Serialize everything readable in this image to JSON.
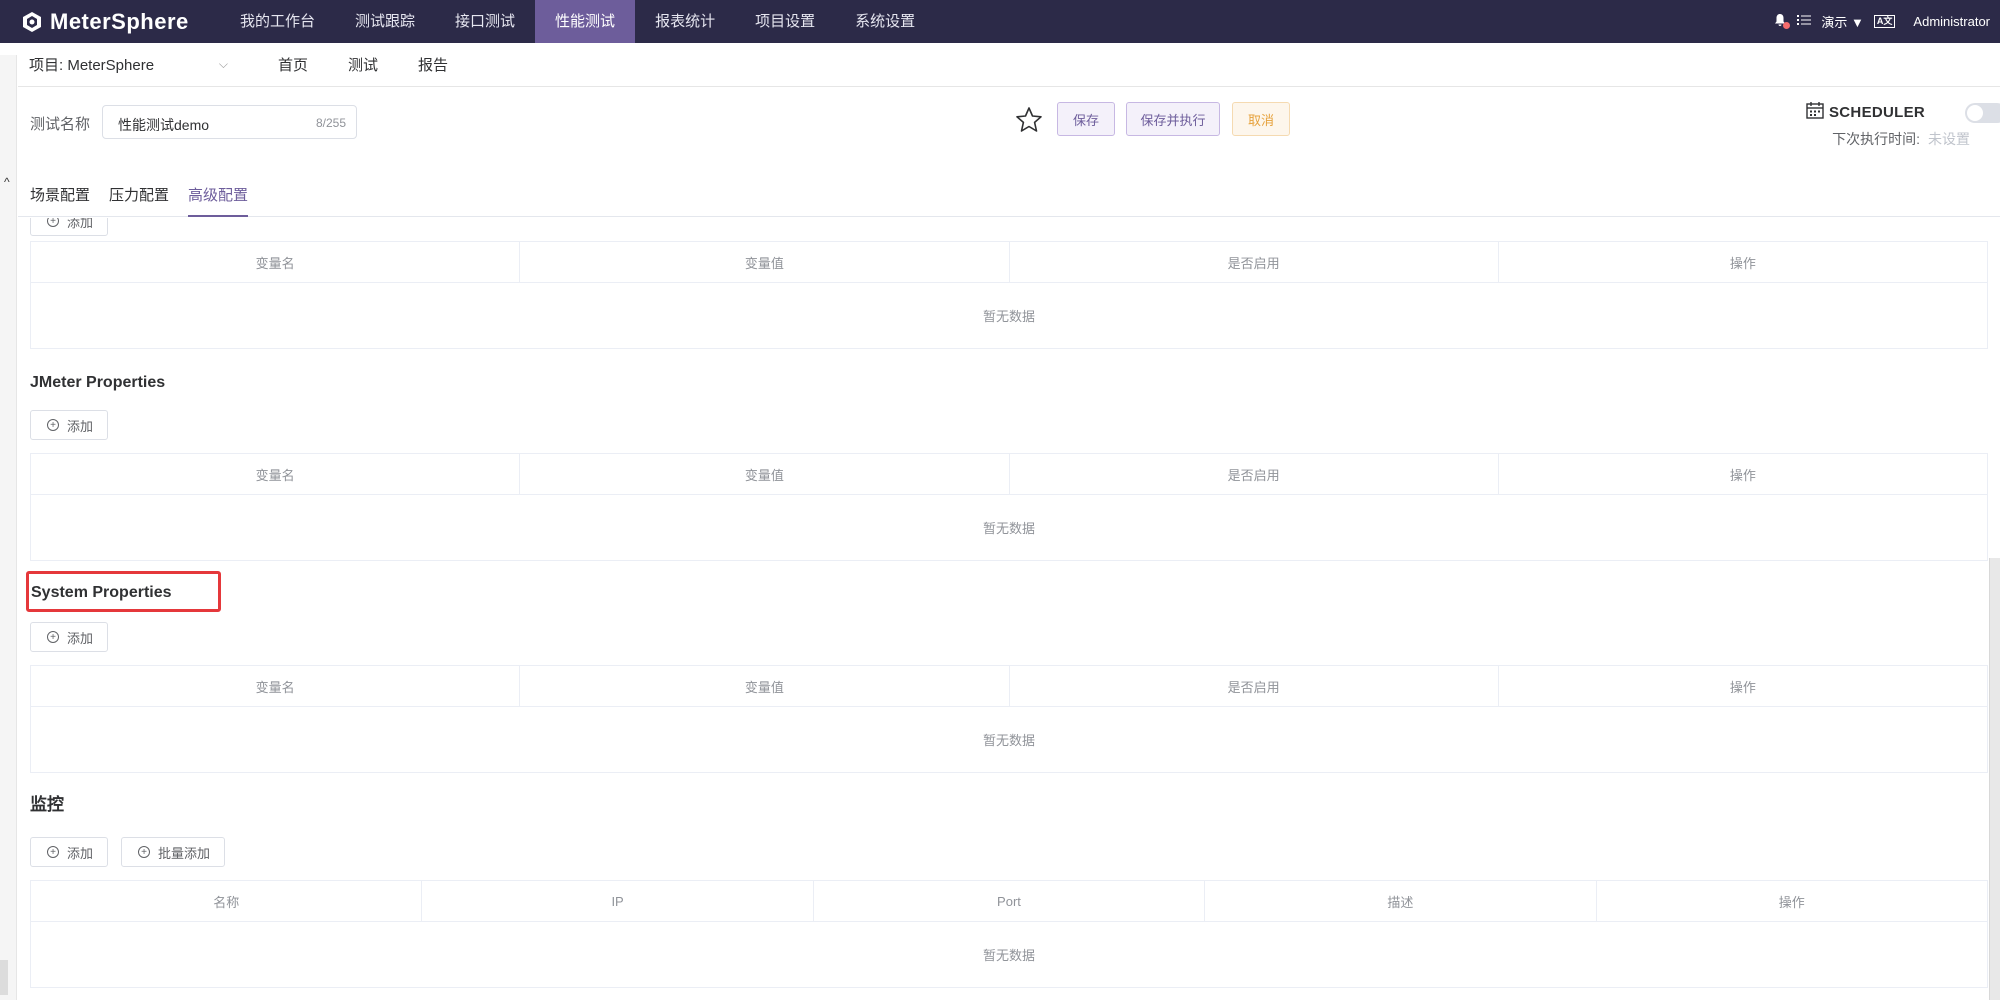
{
  "topnav": {
    "brand": "MeterSphere",
    "menu": [
      "我的工作台",
      "测试跟踪",
      "接口测试",
      "性能测试",
      "报表统计",
      "项目设置",
      "系统设置"
    ],
    "active_index": 3,
    "workspace": "演示",
    "lang": "A",
    "user": "Administrator"
  },
  "subnav": {
    "project": "项目: MeterSphere",
    "links": [
      "首页",
      "测试",
      "报告"
    ]
  },
  "header": {
    "name_label": "测试名称",
    "name_value": "性能测试demo",
    "name_count": "8/255",
    "save": "保存",
    "save_run": "保存并执行",
    "cancel": "取消",
    "scheduler": "SCHEDULER",
    "next_exec_label": "下次执行时间:",
    "next_exec_value": "未设置"
  },
  "tabs": [
    "场景配置",
    "压力配置",
    "高级配置"
  ],
  "active_tab": 2,
  "add_label": "添加",
  "batch_add_label": "批量添加",
  "empty_text": "暂无数据",
  "var_columns": [
    "变量名",
    "变量值",
    "是否启用",
    "操作"
  ],
  "sections": {
    "jmeter": "JMeter Properties",
    "system": "System Properties",
    "monitor": "监控"
  },
  "monitor_columns": [
    "名称",
    "IP",
    "Port",
    "描述",
    "操作"
  ],
  "colors": {
    "nav_bg": "#2c2a48",
    "accent": "#6d5d9b",
    "highlight": "#e5383b"
  }
}
